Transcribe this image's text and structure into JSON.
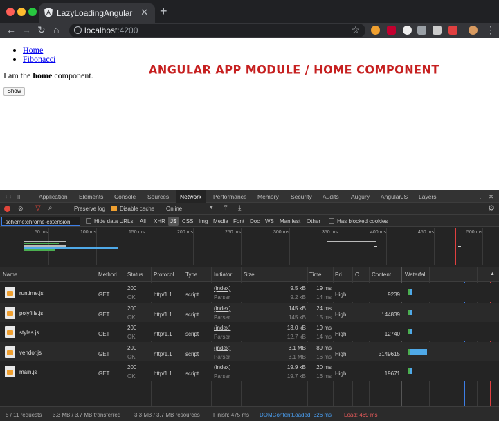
{
  "browser": {
    "tab_title": "LazyLoadingAngular",
    "tab_close": "✕",
    "new_tab": "+",
    "url_host": "localhost",
    "url_port": ":4200"
  },
  "page": {
    "nav_links": [
      "Home",
      "Fibonacci"
    ],
    "intro_before": "I am the ",
    "intro_bold": "home",
    "intro_after": " component.",
    "show_button": "Show",
    "banner": "ANGULAR APP MODULE / HOME COMPONENT"
  },
  "devtools": {
    "tabs": [
      "Application",
      "Elements",
      "Console",
      "Sources",
      "Network",
      "Performance",
      "Memory",
      "Security",
      "Audits",
      "Augury",
      "AngularJS",
      "Layers"
    ],
    "active_tab": "Network",
    "toolbar": {
      "preserve_log": "Preserve log",
      "disable_cache": "Disable cache",
      "throttling": "Online"
    },
    "filter": {
      "value": "-scheme:chrome-extension",
      "hide_data_urls": "Hide data URLs",
      "types": [
        "All",
        "XHR",
        "JS",
        "CSS",
        "Img",
        "Media",
        "Font",
        "Doc",
        "WS",
        "Manifest",
        "Other"
      ],
      "active_type": "JS",
      "blocked_cookies": "Has blocked cookies"
    },
    "timeline_ticks": [
      "50 ms",
      "100 ms",
      "150 ms",
      "200 ms",
      "250 ms",
      "300 ms",
      "350 ms",
      "400 ms",
      "450 ms",
      "500 ms"
    ],
    "columns": [
      "Name",
      "Method",
      "Status",
      "Protocol",
      "Type",
      "Initiator",
      "Size",
      "Time",
      "Pri...",
      "C...",
      "Content...",
      "Waterfall"
    ],
    "requests": [
      {
        "name": "runtime.js",
        "method": "GET",
        "status": "200",
        "status_text": "OK",
        "protocol": "http/1.1",
        "type": "script",
        "initiator": "(index)",
        "initiator_sub": "Parser",
        "size": "9.5 kB",
        "size_sub": "9.2 kB",
        "time": "19 ms",
        "time_sub": "14 ms",
        "priority": "High",
        "content": "9239",
        "wf_start": 0.02,
        "wf_len": 0.02
      },
      {
        "name": "polyfills.js",
        "method": "GET",
        "status": "200",
        "status_text": "OK",
        "protocol": "http/1.1",
        "type": "script",
        "initiator": "(index)",
        "initiator_sub": "Parser",
        "size": "145 kB",
        "size_sub": "145 kB",
        "time": "24 ms",
        "time_sub": "15 ms",
        "priority": "High",
        "content": "144839",
        "wf_start": 0.02,
        "wf_len": 0.025
      },
      {
        "name": "styles.js",
        "method": "GET",
        "status": "200",
        "status_text": "OK",
        "protocol": "http/1.1",
        "type": "script",
        "initiator": "(index)",
        "initiator_sub": "Parser",
        "size": "13.0 kB",
        "size_sub": "12.7 kB",
        "time": "19 ms",
        "time_sub": "14 ms",
        "priority": "High",
        "content": "12740",
        "wf_start": 0.02,
        "wf_len": 0.02
      },
      {
        "name": "vendor.js",
        "method": "GET",
        "status": "200",
        "status_text": "OK",
        "protocol": "http/1.1",
        "type": "script",
        "initiator": "(index)",
        "initiator_sub": "Parser",
        "size": "3.1 MB",
        "size_sub": "3.1 MB",
        "time": "89 ms",
        "time_sub": "16 ms",
        "priority": "High",
        "content": "3149615",
        "wf_start": 0.02,
        "wf_len": 0.18
      },
      {
        "name": "main.js",
        "method": "GET",
        "status": "200",
        "status_text": "OK",
        "protocol": "http/1.1",
        "type": "script",
        "initiator": "(index)",
        "initiator_sub": "Parser",
        "size": "19.9 kB",
        "size_sub": "19.7 kB",
        "time": "20 ms",
        "time_sub": "16 ms",
        "priority": "High",
        "content": "19671",
        "wf_start": 0.02,
        "wf_len": 0.02
      }
    ],
    "status": {
      "requests": "5 / 11 requests",
      "transferred": "3.3 MB / 3.7 MB transferred",
      "resources": "3.3 MB / 3.7 MB resources",
      "finish": "Finish: 475 ms",
      "dcl": "DOMContentLoaded: 326 ms",
      "load": "Load: 469 ms"
    },
    "colors": {
      "dcl": "#3d7ee6",
      "load": "#e04040",
      "accent": "#1a73e8"
    }
  }
}
